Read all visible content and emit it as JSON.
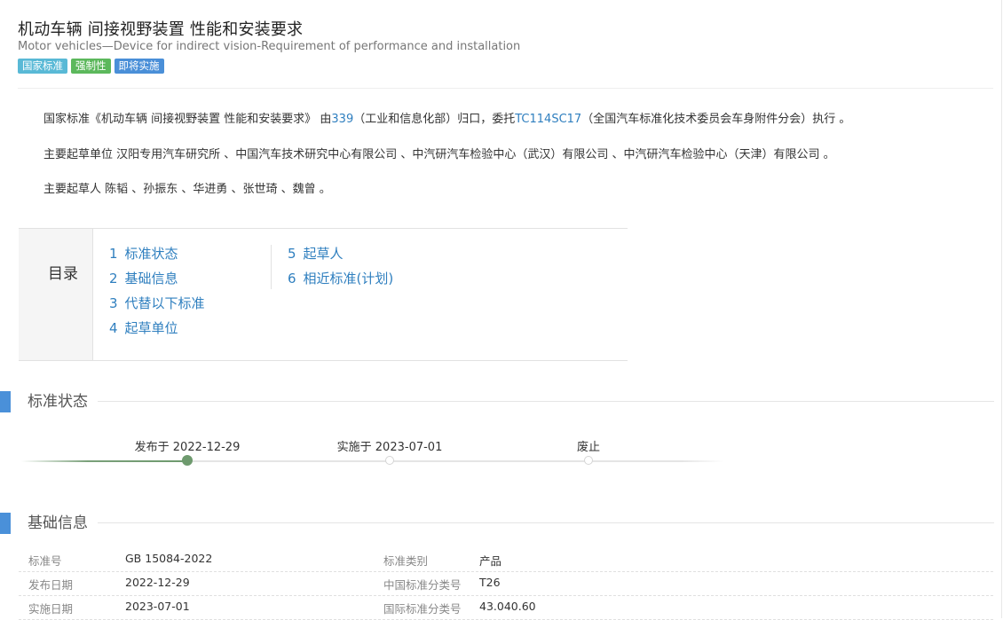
{
  "header": {
    "title_cn": "机动车辆 间接视野装置 性能和安装要求",
    "title_en": "Motor vehicles—Device for indirect vision-Requirement of performance and installation",
    "tags": [
      "国家标准",
      "强制性",
      "即将实施"
    ]
  },
  "summary": {
    "p1_pre": "国家标准《机动车辆 间接视野装置 性能和安装要求》 由",
    "p1_link1": "339",
    "p1_mid": "（工业和信息化部）归口，委托",
    "p1_link2": "TC114SC17",
    "p1_post": "（全国汽车标准化技术委员会车身附件分会）执行 。",
    "p2": "主要起草单位 汉阳专用汽车研究所 、中国汽车技术研究中心有限公司 、中汽研汽车检验中心（武汉）有限公司 、中汽研汽车检验中心（天津）有限公司 。",
    "p3": "主要起草人 陈韬 、孙振东 、华进勇 、张世琦 、魏曾 。"
  },
  "toc": {
    "label": "目录",
    "items": [
      {
        "num": "1",
        "label": "标准状态"
      },
      {
        "num": "2",
        "label": "基础信息"
      },
      {
        "num": "3",
        "label": "代替以下标准"
      },
      {
        "num": "4",
        "label": "起草单位"
      },
      {
        "num": "5",
        "label": "起草人"
      },
      {
        "num": "6",
        "label": "相近标准(计划)"
      }
    ]
  },
  "status": {
    "heading": "标准状态",
    "steps": [
      {
        "label": "发布于 2022-12-29",
        "done": true
      },
      {
        "label": "实施于 2023-07-01",
        "done": false
      },
      {
        "label": "废止",
        "done": false
      }
    ]
  },
  "basic": {
    "heading": "基础信息",
    "rows": [
      {
        "k1": "标准号",
        "v1": "GB 15084-2022",
        "k2": "标准类别",
        "v2": "产品"
      },
      {
        "k1": "发布日期",
        "v1": "2022-12-29",
        "k2": "中国标准分类号",
        "v2": "T26"
      },
      {
        "k1": "实施日期",
        "v1": "2023-07-01",
        "k2": "国际标准分类号",
        "v2": "43.040.60"
      }
    ]
  },
  "colors": {
    "link": "#2f7fbf",
    "section_bar": "#4a90d9",
    "tag_national": "#59b9d6",
    "tag_mandatory": "#5cb85c",
    "tag_upcoming": "#4a8fd8",
    "timeline_done": "#6e9a6e"
  }
}
